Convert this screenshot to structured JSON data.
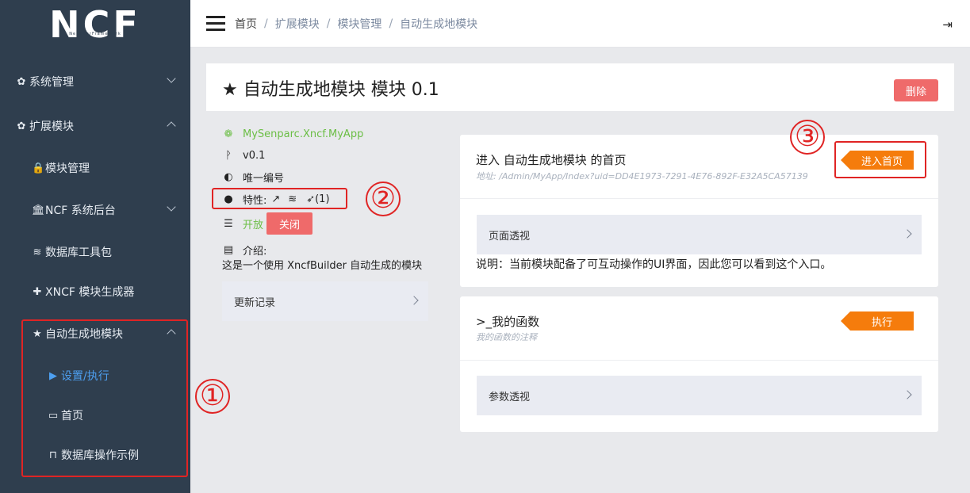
{
  "sidebar": {
    "logo": "NCF",
    "logo_sub": "NeuCharFramework",
    "items": [
      {
        "label": "系统管理",
        "icon": "gear-icon"
      },
      {
        "label": "扩展模块",
        "icon": "gear-icon"
      },
      {
        "label": "模块管理",
        "icon": "lock-icon"
      },
      {
        "label": "NCF 系统后台",
        "icon": "bank-icon"
      },
      {
        "label": "数据库工具包",
        "icon": "database-icon"
      },
      {
        "label": "XNCF 模块生成器",
        "icon": "plus-icon"
      },
      {
        "label": "自动生成地模块",
        "icon": "star-icon"
      },
      {
        "label": "设置/执行",
        "icon": "play-icon"
      },
      {
        "label": "首页",
        "icon": "laptop-icon"
      },
      {
        "label": "数据库操作示例",
        "icon": "bookmark-icon"
      }
    ]
  },
  "breadcrumb": [
    "首页",
    "扩展模块",
    "模块管理",
    "自动生成地模块"
  ],
  "annotations": [
    "①",
    "②",
    "③"
  ],
  "title": {
    "text": "自动生成地模块 模块 0.1",
    "delete_label": "删除"
  },
  "info": {
    "name": "MySenparc.Xncf.MyApp",
    "version": "v0.1",
    "uid_label": "唯一编号",
    "features_label": "特性:",
    "features_count": "(1)",
    "open_label": "开放",
    "close_label": "关闭",
    "intro_label": "介绍:",
    "intro_text": "这是一个使用 XncfBuilder 自动生成的模块",
    "update_log_label": "更新记录"
  },
  "card1": {
    "title": "进入 自动生成地模块 的首页",
    "address": "地址: /Admin/MyApp/Index?uid=DD4E1973-7291-4E76-892F-E32A5CA57139",
    "enter_label": "进入首页",
    "panel_label": "页面透视",
    "note": "说明：当前模块配备了可互动操作的UI界面，因此您可以看到这个入口。"
  },
  "card2": {
    "title": ">_我的函数",
    "sub": "我的函数的注释",
    "run_label": "执行",
    "panel_label": "参数透视"
  },
  "colors": {
    "sidebar_bg": "#2f3e4e",
    "accent_orange": "#f57c0c",
    "danger_red": "#ef6a6a",
    "active_blue": "#4d9ff0",
    "green": "#6bbe45",
    "annotation_red": "#e02424"
  }
}
